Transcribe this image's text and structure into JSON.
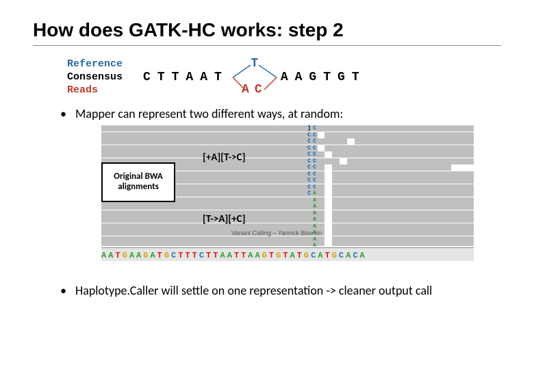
{
  "title": "How does GATK-HC works: step 2",
  "legend": {
    "reference": "Reference",
    "consensus": "Consensus",
    "reads": "Reads"
  },
  "topgraph": {
    "left_seq": "CTTAAT",
    "branch_top": "T",
    "branch_bottom": "AC",
    "right_seq": "AAGTGT"
  },
  "bullet1": "Mapper can represent two different ways, at random:",
  "bullet2": "Haplotype.Caller will settle on one representation -> cleaner output call",
  "bwa_label": "Original BWA alignments",
  "cigar_top": "[+A][T->C]",
  "cigar_bot": "[T->A][+C]",
  "watermark": "Variant Calling – Yannick Boursin",
  "ref_axis_seq": "AATGAAGATGCTTTCTTAATTAAGTGTATGCATGCACA",
  "variant_column1": "]CCCCCCCCCC",
  "variant_column2": "CCCCCCCCCCAAAAAAAAA",
  "read_layout": [
    {
      "l": 0,
      "r": 62,
      "t": 0
    },
    {
      "l": 0,
      "r": 58,
      "t": 9.5
    },
    {
      "l": 0,
      "r": 66,
      "t": 19
    },
    {
      "l": 0,
      "r": 58,
      "t": 28.5
    },
    {
      "l": 0,
      "r": 60,
      "t": 38
    },
    {
      "l": 0,
      "r": 64,
      "t": 47.5
    },
    {
      "l": 0,
      "r": 60,
      "t": 57
    },
    {
      "l": 0,
      "r": 60,
      "t": 66.5
    },
    {
      "l": 0,
      "r": 60,
      "t": 76
    },
    {
      "l": 0,
      "r": 60,
      "t": 85.5
    },
    {
      "l": 62,
      "r": 100,
      "t": 0
    },
    {
      "l": 60,
      "r": 100,
      "t": 9.5
    },
    {
      "l": 68,
      "r": 100,
      "t": 19
    },
    {
      "l": 60,
      "r": 100,
      "t": 28.5
    },
    {
      "l": 62,
      "r": 100,
      "t": 38
    },
    {
      "l": 66,
      "r": 100,
      "t": 47.5
    },
    {
      "l": 62,
      "r": 94,
      "t": 57
    },
    {
      "l": 62,
      "r": 100,
      "t": 66.5
    },
    {
      "l": 62,
      "r": 100,
      "t": 76
    },
    {
      "l": 62,
      "r": 100,
      "t": 85.5
    },
    {
      "l": 0,
      "r": 60,
      "t": 95
    },
    {
      "l": 0,
      "r": 60,
      "t": 104.5
    },
    {
      "l": 0,
      "r": 60,
      "t": 114
    },
    {
      "l": 0,
      "r": 60,
      "t": 123.5
    },
    {
      "l": 0,
      "r": 60,
      "t": 133
    },
    {
      "l": 0,
      "r": 60,
      "t": 142.5
    },
    {
      "l": 0,
      "r": 60,
      "t": 152
    },
    {
      "l": 0,
      "r": 60,
      "t": 161.5
    },
    {
      "l": 0,
      "r": 60,
      "t": 171
    },
    {
      "l": 62,
      "r": 100,
      "t": 95
    },
    {
      "l": 62,
      "r": 100,
      "t": 104.5
    },
    {
      "l": 62,
      "r": 100,
      "t": 114
    },
    {
      "l": 62,
      "r": 100,
      "t": 123.5
    },
    {
      "l": 62,
      "r": 100,
      "t": 133
    },
    {
      "l": 62,
      "r": 100,
      "t": 142.5
    },
    {
      "l": 62,
      "r": 100,
      "t": 152
    },
    {
      "l": 62,
      "r": 100,
      "t": 161.5
    },
    {
      "l": 62,
      "r": 100,
      "t": 171
    }
  ]
}
